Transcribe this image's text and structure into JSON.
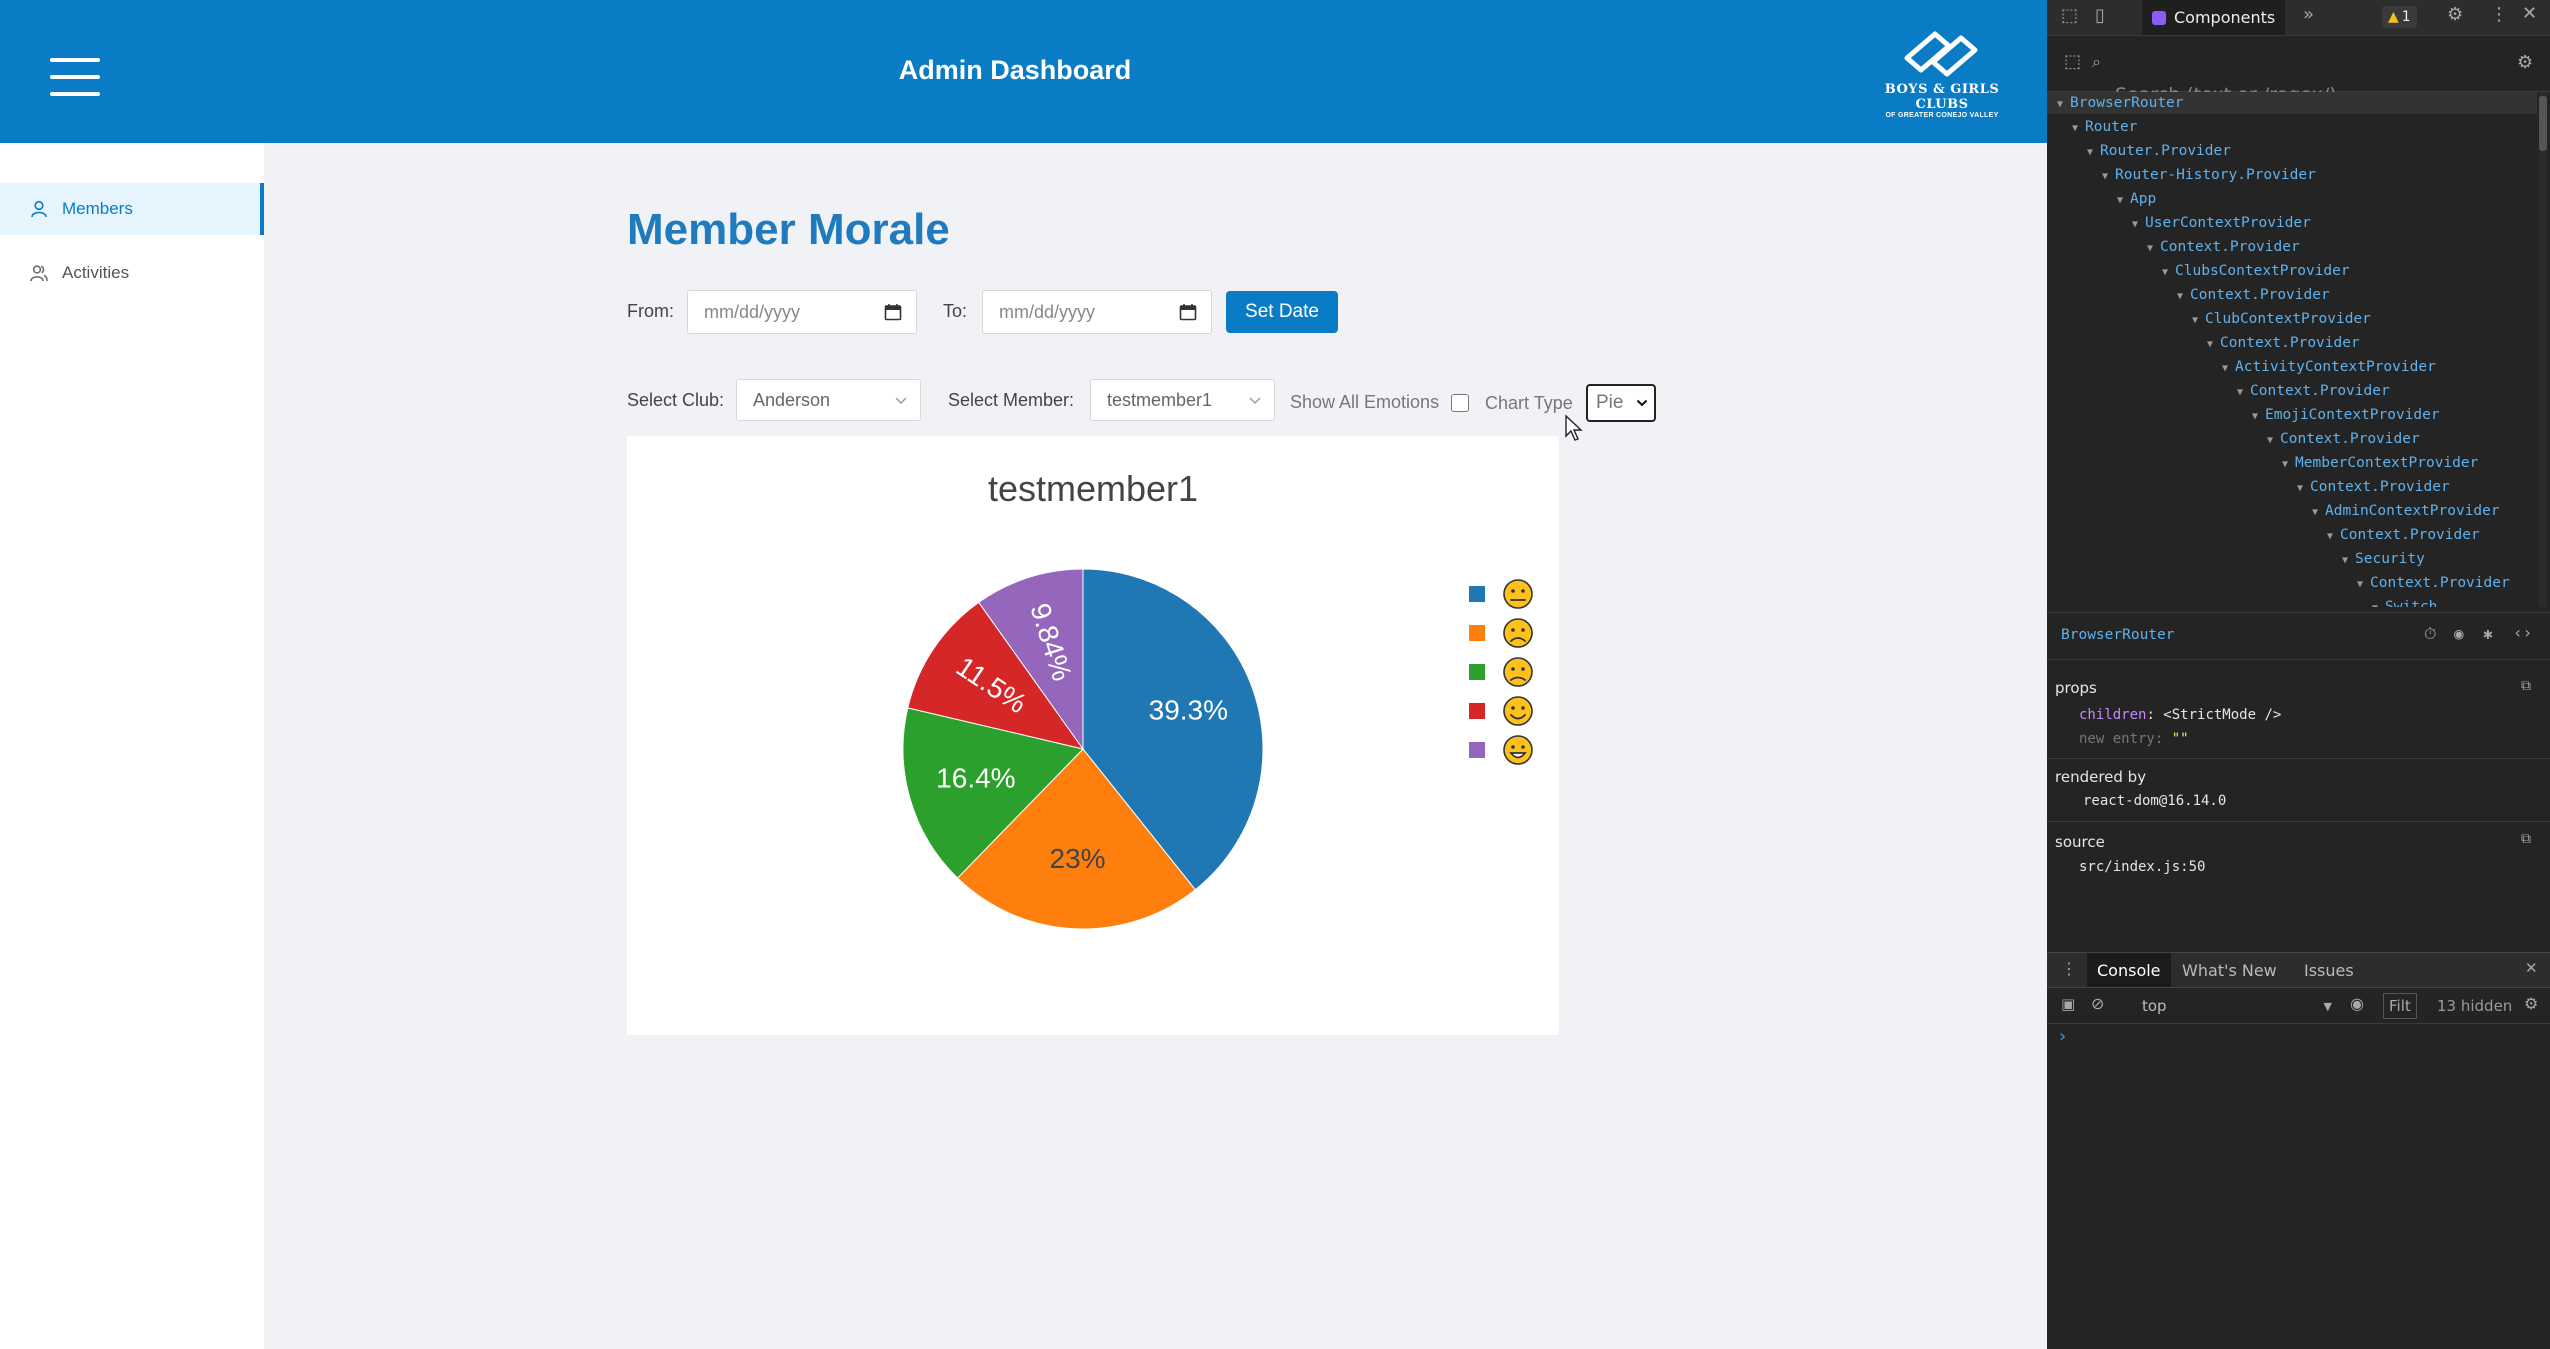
{
  "header": {
    "title": "Admin Dashboard",
    "logo_line1": "BOYS & GIRLS CLUBS",
    "logo_line2": "OF GREATER CONEJO VALLEY"
  },
  "sidebar": {
    "items": [
      {
        "label": "Members",
        "active": true
      },
      {
        "label": "Activities",
        "active": false
      }
    ]
  },
  "page": {
    "title": "Member Morale"
  },
  "filters": {
    "from_label": "From:",
    "from_placeholder": "mm/dd/yyyy",
    "to_label": "To:",
    "to_placeholder": "mm/dd/yyyy",
    "set_date_label": "Set Date",
    "club_label": "Select Club:",
    "club_value": "Anderson",
    "member_label": "Select Member:",
    "member_value": "testmember1",
    "show_all_label": "Show All Emotions",
    "show_all_checked": false,
    "chart_type_label": "Chart Type",
    "chart_type_value": "Pie"
  },
  "chart_data": {
    "type": "pie",
    "title": "testmember1",
    "slices": [
      {
        "label": "neutral-face",
        "value": 39.3,
        "display": "39.3%",
        "color": "#1f77b4"
      },
      {
        "label": "worried-face",
        "value": 23.0,
        "display": "23%",
        "color": "#ff7f0e"
      },
      {
        "label": "disappointed-face",
        "value": 16.4,
        "display": "16.4%",
        "color": "#2ca02c"
      },
      {
        "label": "smiling-face",
        "value": 11.5,
        "display": "11.5%",
        "color": "#d62728"
      },
      {
        "label": "grinning-face",
        "value": 9.84,
        "display": "9.84%",
        "color": "#9467bd"
      }
    ],
    "legend_order": [
      0,
      1,
      2,
      3,
      4
    ],
    "legend_placement": "right"
  },
  "devtools": {
    "tab_components": "Components",
    "warning_count": "1",
    "search_placeholder": "Search (text or /regex/)",
    "tree": [
      {
        "name": "BrowserRouter",
        "depth": 0
      },
      {
        "name": "Router",
        "depth": 1
      },
      {
        "name": "Router.Provider",
        "depth": 2
      },
      {
        "name": "Router-History.Provider",
        "depth": 3
      },
      {
        "name": "App",
        "depth": 4
      },
      {
        "name": "UserContextProvider",
        "depth": 5
      },
      {
        "name": "Context.Provider",
        "depth": 6
      },
      {
        "name": "ClubsContextProvider",
        "depth": 7
      },
      {
        "name": "Context.Provider",
        "depth": 8
      },
      {
        "name": "ClubContextProvider",
        "depth": 9
      },
      {
        "name": "Context.Provider",
        "depth": 10
      },
      {
        "name": "ActivityContextProvider",
        "depth": 11
      },
      {
        "name": "Context.Provider",
        "depth": 12
      },
      {
        "name": "EmojiContextProvider",
        "depth": 13
      },
      {
        "name": "Context.Provider",
        "depth": 14
      },
      {
        "name": "MemberContextProvider",
        "depth": 15
      },
      {
        "name": "Context.Provider",
        "depth": 16
      },
      {
        "name": "AdminContextProvider",
        "depth": 17
      },
      {
        "name": "Context.Provider",
        "depth": 18
      },
      {
        "name": "Security",
        "depth": 19
      },
      {
        "name": "Context.Provider",
        "depth": 20
      },
      {
        "name": "Switch",
        "depth": 21
      }
    ],
    "selected": "BrowserRouter",
    "props_title": "props",
    "prop_key": "children",
    "prop_value": "<StrictMode />",
    "new_entry_label": "new entry",
    "new_entry_value": "\"\"",
    "rendered_by_title": "rendered by",
    "rendered_by_value": "react-dom@16.14.0",
    "source_title": "source",
    "source_value": "src/index.js:50",
    "console_tabs": [
      "Console",
      "What's New",
      "Issues"
    ],
    "context": "top",
    "filter_placeholder": "Filt",
    "hidden_count": "13 hidden"
  }
}
